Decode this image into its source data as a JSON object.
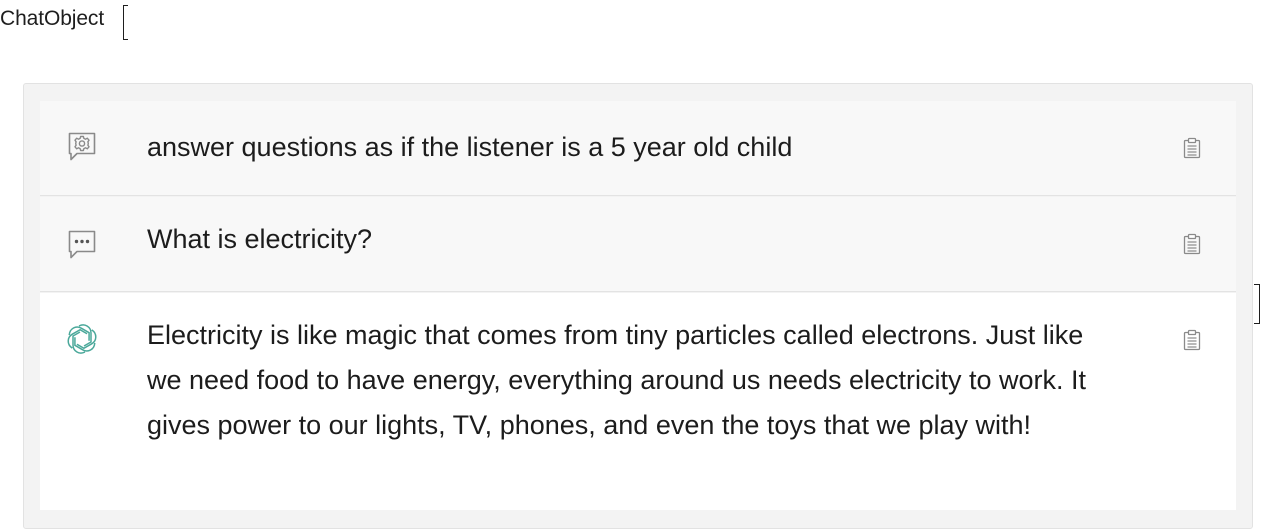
{
  "header": {
    "label": "ChatObject"
  },
  "messages": [
    {
      "role": "system",
      "icon": "gear-bubble-icon",
      "text": "answer questions as if the listener is a 5 year old child"
    },
    {
      "role": "user",
      "icon": "chat-bubble-icon",
      "text": "What is electricity?"
    },
    {
      "role": "assistant",
      "icon": "openai-logo-icon",
      "text": "Electricity is like magic that comes from tiny particles called electrons. Just like we need food to have energy, everything around us needs electricity to work. It gives power to our lights, TV, phones, and even the toys that we play with!"
    }
  ],
  "colors": {
    "icon_gray": "#8a8a8a",
    "assistant_logo": "#4aa89a"
  }
}
